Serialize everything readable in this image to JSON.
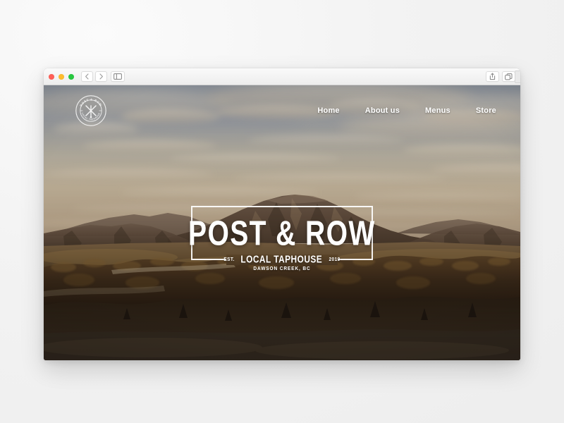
{
  "window": {
    "traffic_lights": [
      "close",
      "minimize",
      "maximize"
    ],
    "nav_back_label": "Back",
    "nav_forward_label": "Forward",
    "sidebar_toggle_label": "Show Sidebar",
    "share_label": "Share",
    "tabs_overview_label": "Tab Overview",
    "new_tab_label": "+"
  },
  "site": {
    "logo": {
      "icon": "circular-badge-logo",
      "arc_top_text": "POST & ROW",
      "arc_bottom_text": "LOCAL TAPHOUSE"
    },
    "nav": [
      {
        "label": "Home",
        "name": "nav-link-home"
      },
      {
        "label": "About us",
        "name": "nav-link-about-us"
      },
      {
        "label": "Menus",
        "name": "nav-link-menus"
      },
      {
        "label": "Store",
        "name": "nav-link-store"
      }
    ],
    "hero": {
      "title": "POST & ROW",
      "est_label": "EST.",
      "tagline": "LOCAL TAPHOUSE",
      "year": "2019",
      "location": "DAWSON CREEK, BC"
    }
  },
  "colors": {
    "desktop_bg": "#f2f2f2",
    "chrome_bg": "#ededed",
    "text_on_hero": "#ffffff",
    "sky_top": "#8b94a2",
    "sky_warm": "#cbb397",
    "ridge": "#6d5b4c",
    "foreground": "#2a1d12",
    "traffic_close": "#ff5f57",
    "traffic_min": "#febc2e",
    "traffic_max": "#28c840"
  }
}
